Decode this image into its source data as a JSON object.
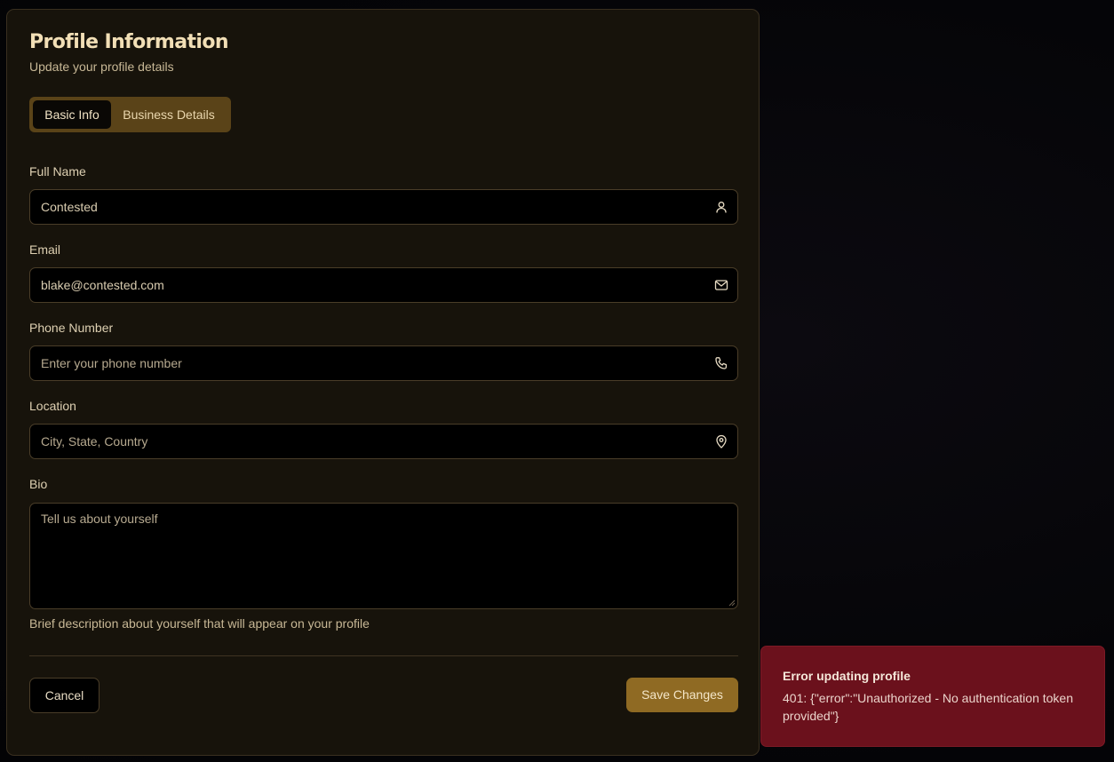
{
  "header": {
    "title": "Profile Information",
    "subtitle": "Update your profile details"
  },
  "tabs": [
    {
      "label": "Basic Info",
      "active": true
    },
    {
      "label": "Business Details",
      "active": false
    }
  ],
  "form": {
    "full_name": {
      "label": "Full Name",
      "value": "Contested",
      "icon": "user-icon"
    },
    "email": {
      "label": "Email",
      "value": "blake@contested.com",
      "icon": "mail-icon"
    },
    "phone": {
      "label": "Phone Number",
      "placeholder": "Enter your phone number",
      "icon": "phone-icon"
    },
    "location": {
      "label": "Location",
      "placeholder": "City, State, Country",
      "icon": "map-pin-icon"
    },
    "bio": {
      "label": "Bio",
      "placeholder": "Tell us about yourself",
      "help": "Brief description about yourself that will appear on your profile"
    }
  },
  "actions": {
    "cancel_label": "Cancel",
    "save_label": "Save Changes"
  },
  "toast": {
    "title": "Error updating profile",
    "message": "401: {\"error\":\"Unauthorized - No authentication token provided\"}"
  },
  "colors": {
    "card_bg": "#17130b",
    "accent": "#8f6a23",
    "tab_bar": "#5a4318",
    "error_bg": "#6b111c"
  }
}
